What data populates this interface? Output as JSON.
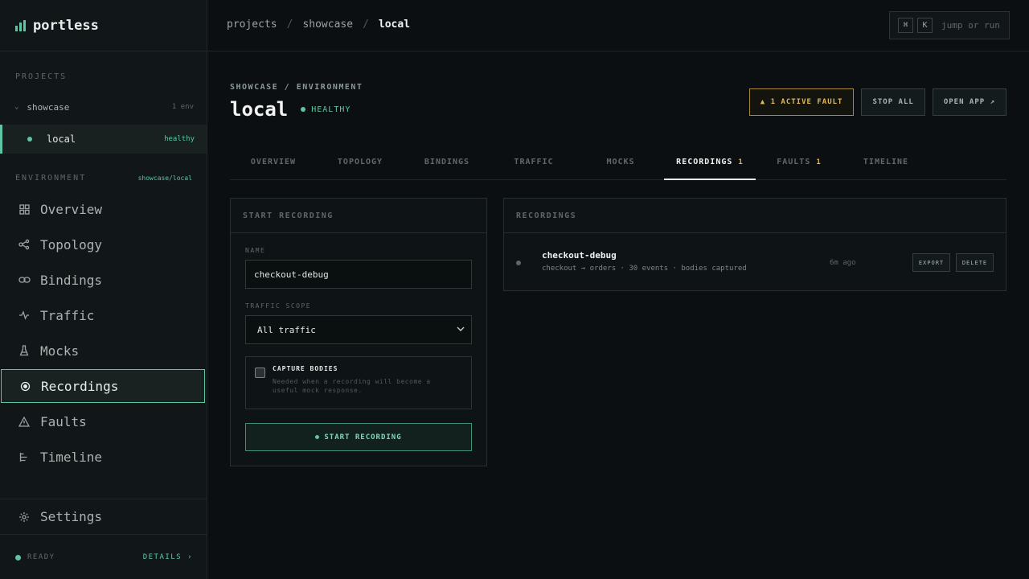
{
  "app": {
    "name": "portless"
  },
  "sidebar": {
    "projects_label": "PROJECTS",
    "project": {
      "name": "showcase",
      "meta": "1 env"
    },
    "env": {
      "name": "local",
      "status": "healthy"
    },
    "environment_label": "ENVIRONMENT",
    "environment_path": "showcase/local",
    "nav": [
      {
        "label": "Overview",
        "icon": "grid-icon"
      },
      {
        "label": "Topology",
        "icon": "topology-icon"
      },
      {
        "label": "Bindings",
        "icon": "link-icon"
      },
      {
        "label": "Traffic",
        "icon": "pulse-icon"
      },
      {
        "label": "Mocks",
        "icon": "flask-icon"
      },
      {
        "label": "Recordings",
        "icon": "record-icon",
        "active": true
      },
      {
        "label": "Faults",
        "icon": "warning-icon"
      },
      {
        "label": "Timeline",
        "icon": "timeline-icon"
      }
    ],
    "settings_label": "Settings",
    "status": {
      "ready": "READY",
      "details": "DETAILS ›"
    }
  },
  "topbar": {
    "breadcrumb": [
      "projects",
      "showcase",
      "local"
    ],
    "separator": "/",
    "kbd": [
      "⌘",
      "K"
    ],
    "cmd_hint": "jump or run"
  },
  "header": {
    "crumb": "SHOWCASE / ENVIRONMENT",
    "title": "local",
    "health": "HEALTHY",
    "actions": {
      "fault": "▲ 1 ACTIVE FAULT",
      "stop": "STOP ALL",
      "open": "OPEN APP ↗"
    }
  },
  "tabs": [
    {
      "label": "OVERVIEW"
    },
    {
      "label": "TOPOLOGY"
    },
    {
      "label": "BINDINGS"
    },
    {
      "label": "TRAFFIC"
    },
    {
      "label": "MOCKS"
    },
    {
      "label": "RECORDINGS",
      "badge": "1",
      "active": true
    },
    {
      "label": "FAULTS",
      "badge": "1"
    },
    {
      "label": "TIMELINE"
    }
  ],
  "form": {
    "title": "START RECORDING",
    "name_label": "NAME",
    "name_value": "checkout-debug",
    "scope_label": "TRAFFIC SCOPE",
    "scope_value": "All traffic",
    "capture_title": "CAPTURE BODIES",
    "capture_desc": "Needed when a recording will become a useful mock response.",
    "start_label": "START RECORDING"
  },
  "recordings": {
    "title": "RECORDINGS",
    "items": [
      {
        "name": "checkout-debug",
        "meta": "checkout → orders · 30 events · bodies captured",
        "time": "6m ago",
        "export": "EXPORT",
        "delete": "DELETE"
      }
    ]
  },
  "colors": {
    "accent": "#5ec4a1",
    "warning": "#e2b858",
    "background": "#0b0f11"
  }
}
